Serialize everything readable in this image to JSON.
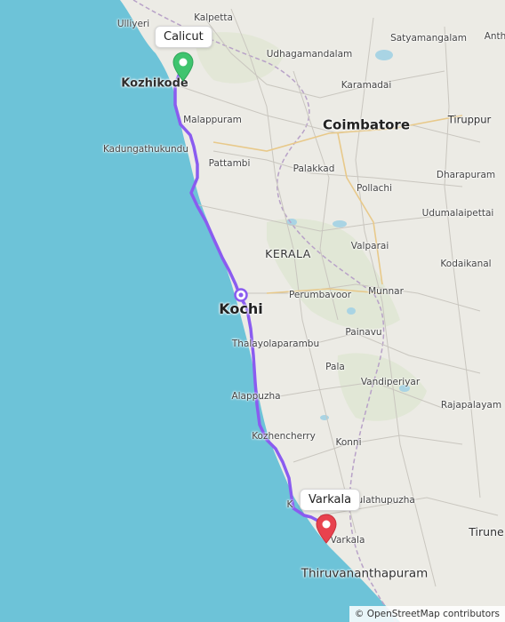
{
  "map": {
    "origin": {
      "label": "Calicut",
      "marker_color": "#3fc46e",
      "icon": "location-pin-icon"
    },
    "destination": {
      "label": "Varkala",
      "marker_color": "#e8424e",
      "icon": "location-pin-icon"
    },
    "route_color": "#8a5cf0",
    "waypoint_icon": "waypoint-icon",
    "attribution": "© OpenStreetMap contributors",
    "places": {
      "ulliyeri": "Ulliyeri",
      "kalpetta": "Kalpetta",
      "sathyamangalam": "Satyamangalam",
      "anthiyur": "Anth",
      "udhagamandalam": "Udhagamandalam",
      "kozhikode": "Kozhikode",
      "karamadai": "Karamadai",
      "malappuram": "Malappuram",
      "coimbatore": "Coimbatore",
      "tiruppur": "Tiruppur",
      "kadungathukundu": "Kadungathukundu",
      "pattambi": "Pattambi",
      "palakkad": "Palakkad",
      "dharapuram": "Dharapuram",
      "pollachi": "Pollachi",
      "udumalaipettai": "Udumalaipettai",
      "valparai": "Valparai",
      "kerala": "KERALA",
      "kodaikanal": "Kodaikanal",
      "perumbavoor": "Perumbavoor",
      "munnar": "Munnar",
      "kochi": "Kochi",
      "thalayolaparambu": "Thalayolaparambu",
      "painavu": "Painavu",
      "pala": "Pala",
      "vandiperiyar": "Vandiperiyar",
      "alappuzha": "Alappuzha",
      "rajapalayam": "Rajapalayam",
      "kozhencherry": "Kozhencherry",
      "konni": "Konni",
      "kulathupuzha": "Kulathupuzha",
      "varkala_town": "Varkala",
      "tirunelveli": "Tirune",
      "thiruvananthapuram": "Thiruvananthapuram",
      "ko_partial": "K"
    }
  }
}
